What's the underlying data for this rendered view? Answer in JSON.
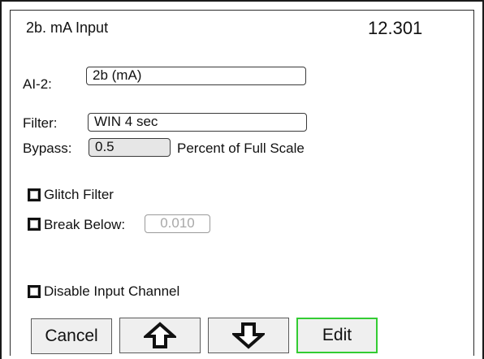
{
  "header": {
    "title": "2b. mA Input",
    "value": "12.301"
  },
  "ai2": {
    "label": "AI-2:",
    "value": "2b (mA)"
  },
  "filter": {
    "label": "Filter:",
    "value": "WIN 4 sec"
  },
  "bypass": {
    "label": "Bypass:",
    "value": "0.5",
    "unit_label": "Percent of Full Scale"
  },
  "glitch_filter": {
    "label": "Glitch Filter",
    "checked": false
  },
  "break_below": {
    "label": "Break Below:",
    "checked": false,
    "value": "0.010"
  },
  "disable_input": {
    "label": "Disable Input Channel",
    "checked": false
  },
  "buttons": {
    "cancel_label": "Cancel",
    "up_icon": "arrow-up-icon",
    "down_icon": "arrow-down-icon",
    "edit_label": "Edit",
    "edit_border_color": "#33cc33"
  }
}
